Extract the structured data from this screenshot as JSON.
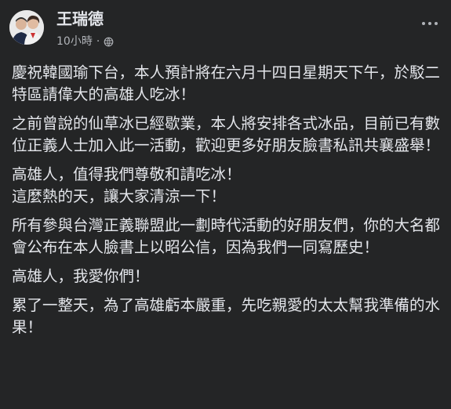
{
  "post": {
    "author": "王瑞德",
    "timestamp": "10小時",
    "separator": "·",
    "privacy_icon": "globe-icon",
    "more_icon": "more-options-icon",
    "paragraphs": [
      "慶祝韓國瑜下台，本人預計將在六月十四日星期天下午，於駁二特區請偉大的高雄人吃冰！",
      "之前曾說的仙草冰已經歇業，本人將安排各式冰品，目前已有數位正義人士加入此一活動，歡迎更多好朋友臉書私訊共襄盛舉！",
      "高雄人，值得我們尊敬和請吃冰！\n這麼熱的天，讓大家清涼一下！",
      "所有參與台灣正義聯盟此一劃時代活動的好朋友們，你的大名都會公布在本人臉書上以昭公信，因為我們一同寫歷史！",
      "高雄人，我愛你們！",
      "累了一整天，為了高雄虧本嚴重，先吃親愛的太太幫我準備的水果！"
    ]
  },
  "colors": {
    "background": "#242526",
    "primary_text": "#e4e6eb",
    "secondary_text": "#b0b3b8"
  }
}
